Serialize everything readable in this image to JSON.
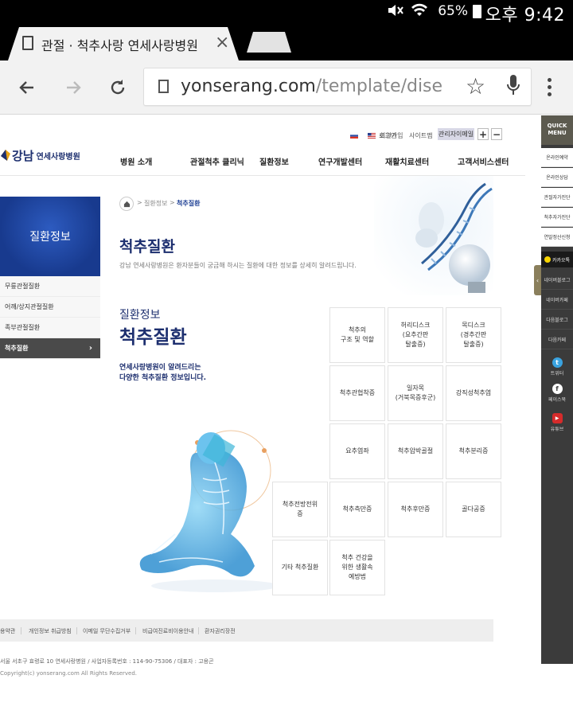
{
  "status_bar": {
    "battery": "65%",
    "time": "오후 9:42"
  },
  "browser": {
    "tab_title": "관절 · 척추사랑 연세사랑병원",
    "tab_close": "×",
    "url_host": "yonserang.com",
    "url_path": "/template/disease/s"
  },
  "site": {
    "util": {
      "login": "로그인",
      "join": "회원가입",
      "sitemap": "사이트맵",
      "admin": "관리자이메일",
      "zoom_in": "+",
      "zoom_out": "−"
    },
    "logo": {
      "brand": "강남",
      "sub": "연세사랑병원"
    },
    "gnb": [
      "병원 소개",
      "관절척추 클리닉",
      "질환정보",
      "연구개발센터",
      "재활치료센터",
      "고객서비스센터"
    ],
    "lnb": {
      "title": "질환정보",
      "items": [
        "무릎관절질환",
        "어깨/상지관절질환",
        "족부관절질환",
        "척추질환"
      ]
    },
    "breadcrumb": {
      "level1": "질환정보",
      "current": "척추질환",
      "sep": ">"
    },
    "page_title": "척추질환",
    "page_desc": "강남 연세사랑병원은 환자분들이 궁금해 하시는 질환에 대한 정보를 상세히 알려드립니다.",
    "section": {
      "category": "질환정보",
      "title": "척추질환",
      "desc_line1": "연세사랑병원이 알려드리는",
      "desc_line2": "다양한 척추질환 정보입니다."
    },
    "grid": [
      "척추의\n구조 및 역할",
      "허리디스크\n(요추간판\n탈출증)",
      "목디스크\n(경추간판\n탈출증)",
      "척추관협착증",
      "일자목\n(거북목증후군)",
      "강직성척추염",
      "요추염좌",
      "척추압박골절",
      "척추분리증",
      "척추전방전위\n증",
      "척추측만증",
      "척추후만증",
      "골다공증",
      "기타 척추질환",
      "척추 건강을\n위한 생활속\n예방법"
    ],
    "footer": {
      "links": [
        "용약관",
        "개인정보 취급방침",
        "이메일 무단수집거부",
        "비급여진료비이용안내",
        "환자권리장전"
      ],
      "address": "서울 서초구 효령로 10 연세사랑병원 / 사업자등록번호 : 114-90-75306 / 대표자 : 고용곤",
      "copyright": "Copyright(c) yonserang.com All Rights Reserved."
    },
    "quick_menu": {
      "head_line1": "QUICK",
      "head_line2": "MENU",
      "white_items": [
        "온라인예약",
        "온라인상담",
        "관절자가진단",
        "척추자가진단",
        "연말정산신청"
      ],
      "kakao": "카카오톡",
      "dark_items": [
        "네이버블로그",
        "네이버카페",
        "다음블로그",
        "다음카페"
      ],
      "sns": [
        "트위터",
        "페이스북",
        "유튜브"
      ],
      "tab_arrow": "‹"
    }
  }
}
